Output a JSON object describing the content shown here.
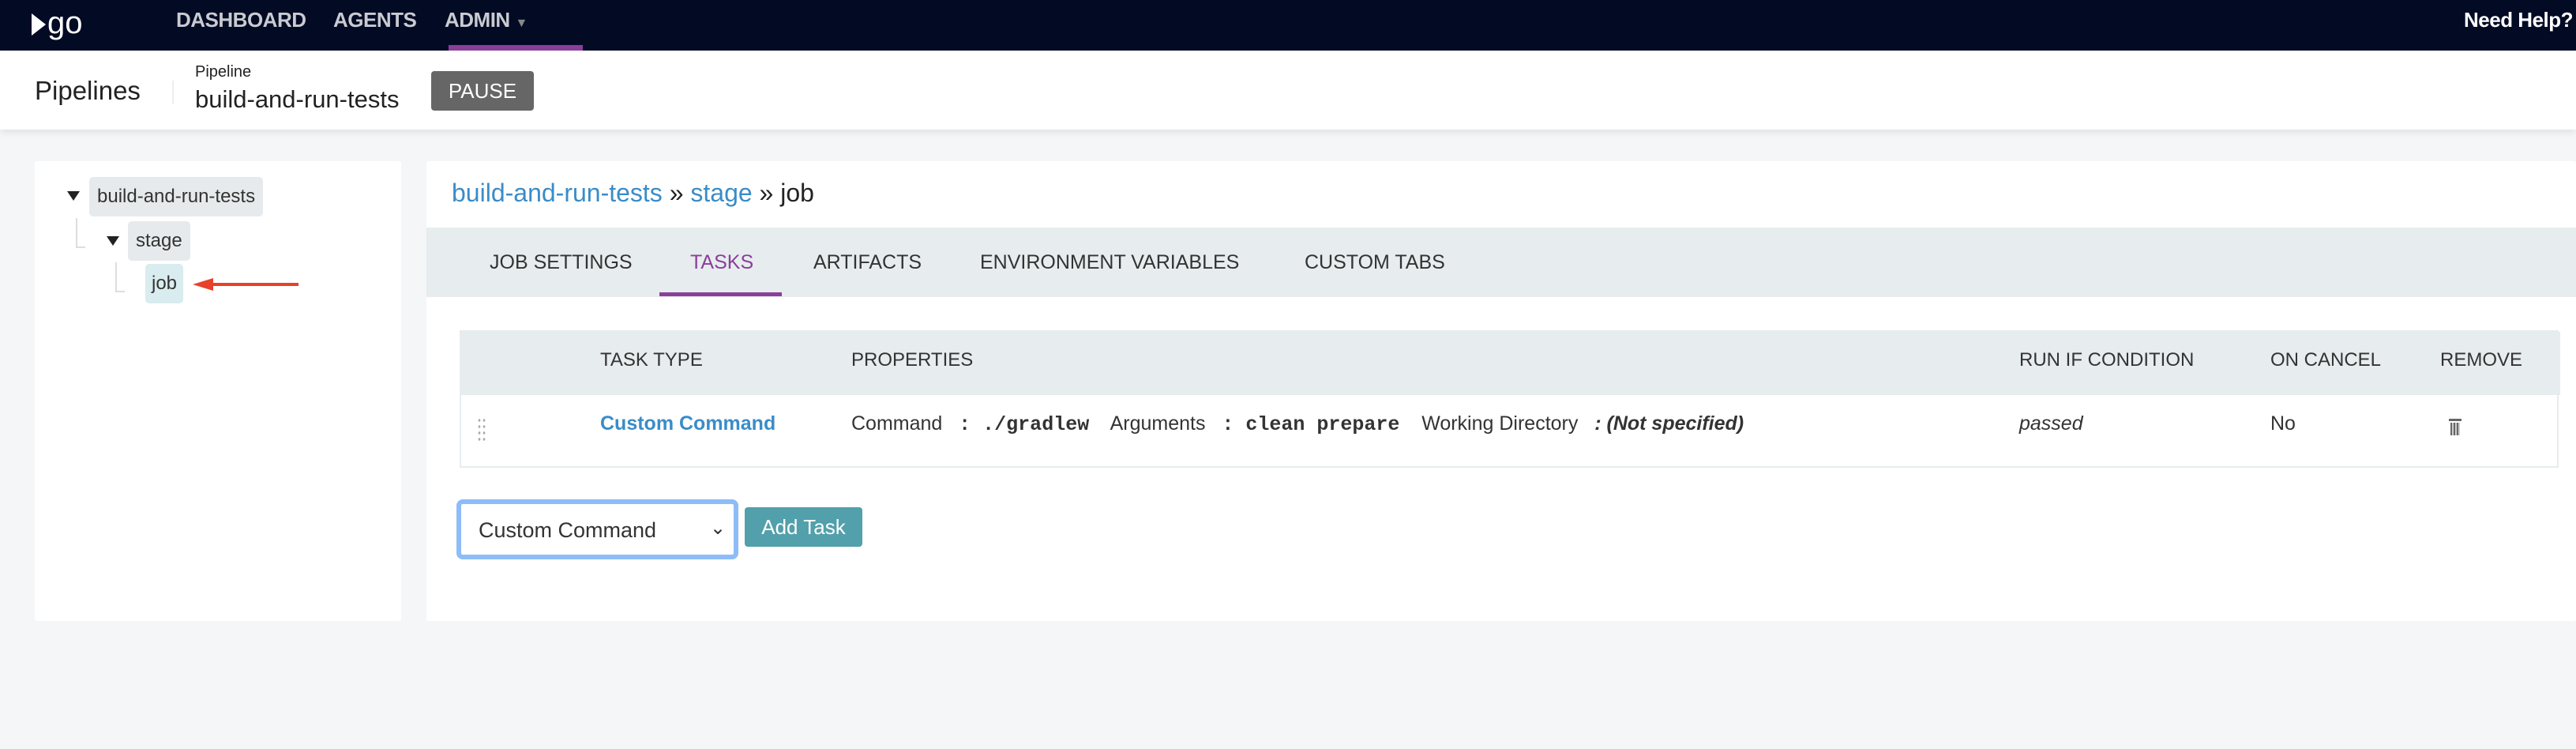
{
  "topnav": {
    "logo": "go",
    "items": [
      {
        "label": "DASHBOARD"
      },
      {
        "label": "AGENTS"
      },
      {
        "label": "ADMIN",
        "active": true
      }
    ],
    "help": "Need Help?"
  },
  "header": {
    "section": "Pipelines",
    "pipeline_label": "Pipeline",
    "pipeline_name": "build-and-run-tests",
    "pause": "PAUSE"
  },
  "tree": {
    "pipeline": "build-and-run-tests",
    "stage": "stage",
    "job": "job"
  },
  "breadcrumb": {
    "pipeline": "build-and-run-tests",
    "sep": "»",
    "stage": "stage",
    "job": "job"
  },
  "tabs": [
    {
      "label": "JOB SETTINGS"
    },
    {
      "label": "TASKS",
      "active": true
    },
    {
      "label": "ARTIFACTS"
    },
    {
      "label": "ENVIRONMENT VARIABLES"
    },
    {
      "label": "CUSTOM TABS"
    }
  ],
  "table": {
    "headers": [
      "TASK TYPE",
      "PROPERTIES",
      "RUN IF CONDITION",
      "ON CANCEL",
      "REMOVE"
    ],
    "rows": [
      {
        "type": "Custom Command",
        "command_label": "Command",
        "command": ": ./gradlew",
        "arguments_label": "Arguments",
        "arguments": ": clean prepare",
        "wd_label": "Working Directory",
        "wd": ": (Not specified)",
        "run_if": "passed",
        "on_cancel": "No"
      }
    ]
  },
  "add_task": {
    "selected": "Custom Command",
    "button": "Add Task"
  },
  "colors": {
    "nav_bg": "#030a24",
    "accent": "#8a3f9a",
    "link": "#3a8cc8",
    "add_btn": "#52a0ab",
    "arrow": "#e8402a"
  }
}
